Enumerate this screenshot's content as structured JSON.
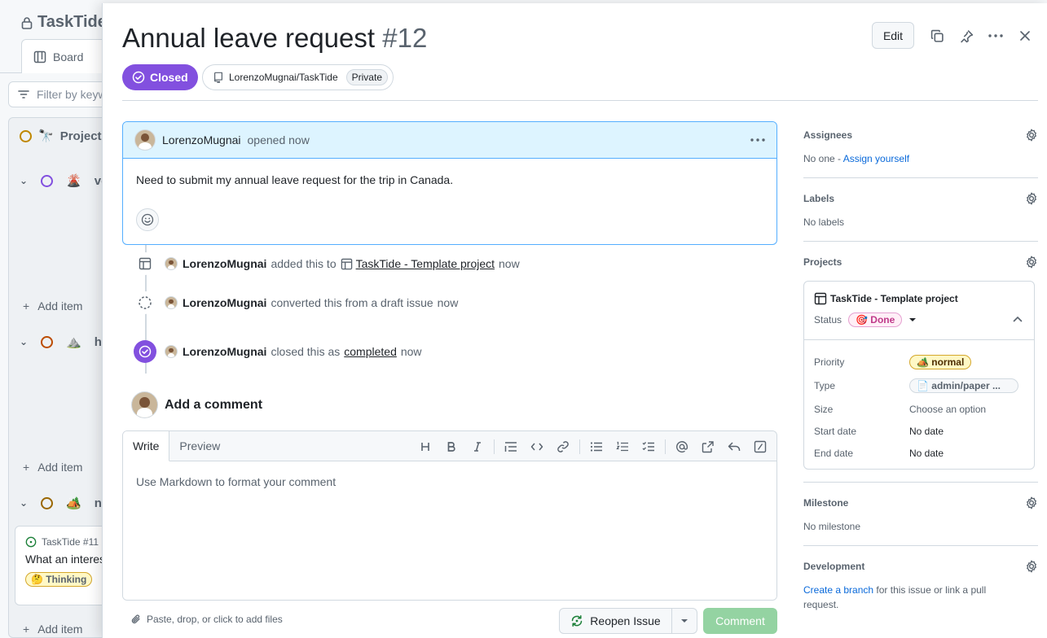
{
  "background": {
    "board_title": "TaskTide",
    "tab_board": "Board",
    "filter_placeholder": "Filter by keyword",
    "column_title": "Projects",
    "groups": [
      {
        "emoji": "🌋",
        "label": "ve"
      },
      {
        "emoji": "⛰️",
        "label": "hi"
      },
      {
        "emoji": "🏕️",
        "label": "ne"
      }
    ],
    "add_item": "Add item",
    "card_ref": "TaskTide #11",
    "card_text": "What an interesting",
    "card_label": "🤔 Thinking"
  },
  "issue": {
    "title": "Annual leave request",
    "number": "#12",
    "state": "Closed",
    "repo": "LorenzoMugnai/TaskTide",
    "visibility": "Private"
  },
  "header": {
    "edit_label": "Edit"
  },
  "comment": {
    "author": "LorenzoMugnai",
    "meta": "opened now",
    "body": "Need to submit my annual leave request for the trip in Canada."
  },
  "timeline": [
    {
      "actor": "LorenzoMugnai",
      "action": "added this to",
      "target": "TaskTide - Template project",
      "time": "now"
    },
    {
      "actor": "LorenzoMugnai",
      "action": "converted this from a draft issue",
      "time": "now"
    },
    {
      "actor": "LorenzoMugnai",
      "action": "closed this as",
      "target": "completed",
      "time": "now"
    }
  ],
  "composer": {
    "heading": "Add a comment",
    "tab_write": "Write",
    "tab_preview": "Preview",
    "placeholder": "Use Markdown to format your comment",
    "attach_hint": "Paste, drop, or click to add files",
    "reopen_label": "Reopen Issue",
    "comment_label": "Comment"
  },
  "sidebar": {
    "assignees": {
      "title": "Assignees",
      "value": "No one - ",
      "link": "Assign yourself"
    },
    "labels": {
      "title": "Labels",
      "value": "No labels"
    },
    "projects": {
      "title": "Projects",
      "project_name": "TaskTide - Template project",
      "status_label": "Status",
      "status_value": "🎯 Done",
      "fields": {
        "priority": {
          "key": "Priority",
          "value": "🏕️ normal"
        },
        "type": {
          "key": "Type",
          "value": "📄 admin/paper ..."
        },
        "size": {
          "key": "Size",
          "value": "Choose an option"
        },
        "start_date": {
          "key": "Start date",
          "value": "No date"
        },
        "end_date": {
          "key": "End date",
          "value": "No date"
        }
      }
    },
    "milestone": {
      "title": "Milestone",
      "value": "No milestone"
    },
    "development": {
      "title": "Development",
      "link": "Create a branch",
      "value": " for this issue or link a pull request."
    }
  },
  "colors": {
    "closed_purple": "#8250df",
    "link_blue": "#0969da",
    "comment_header": "#ddf4ff",
    "comment_button": "#94d3a2"
  }
}
